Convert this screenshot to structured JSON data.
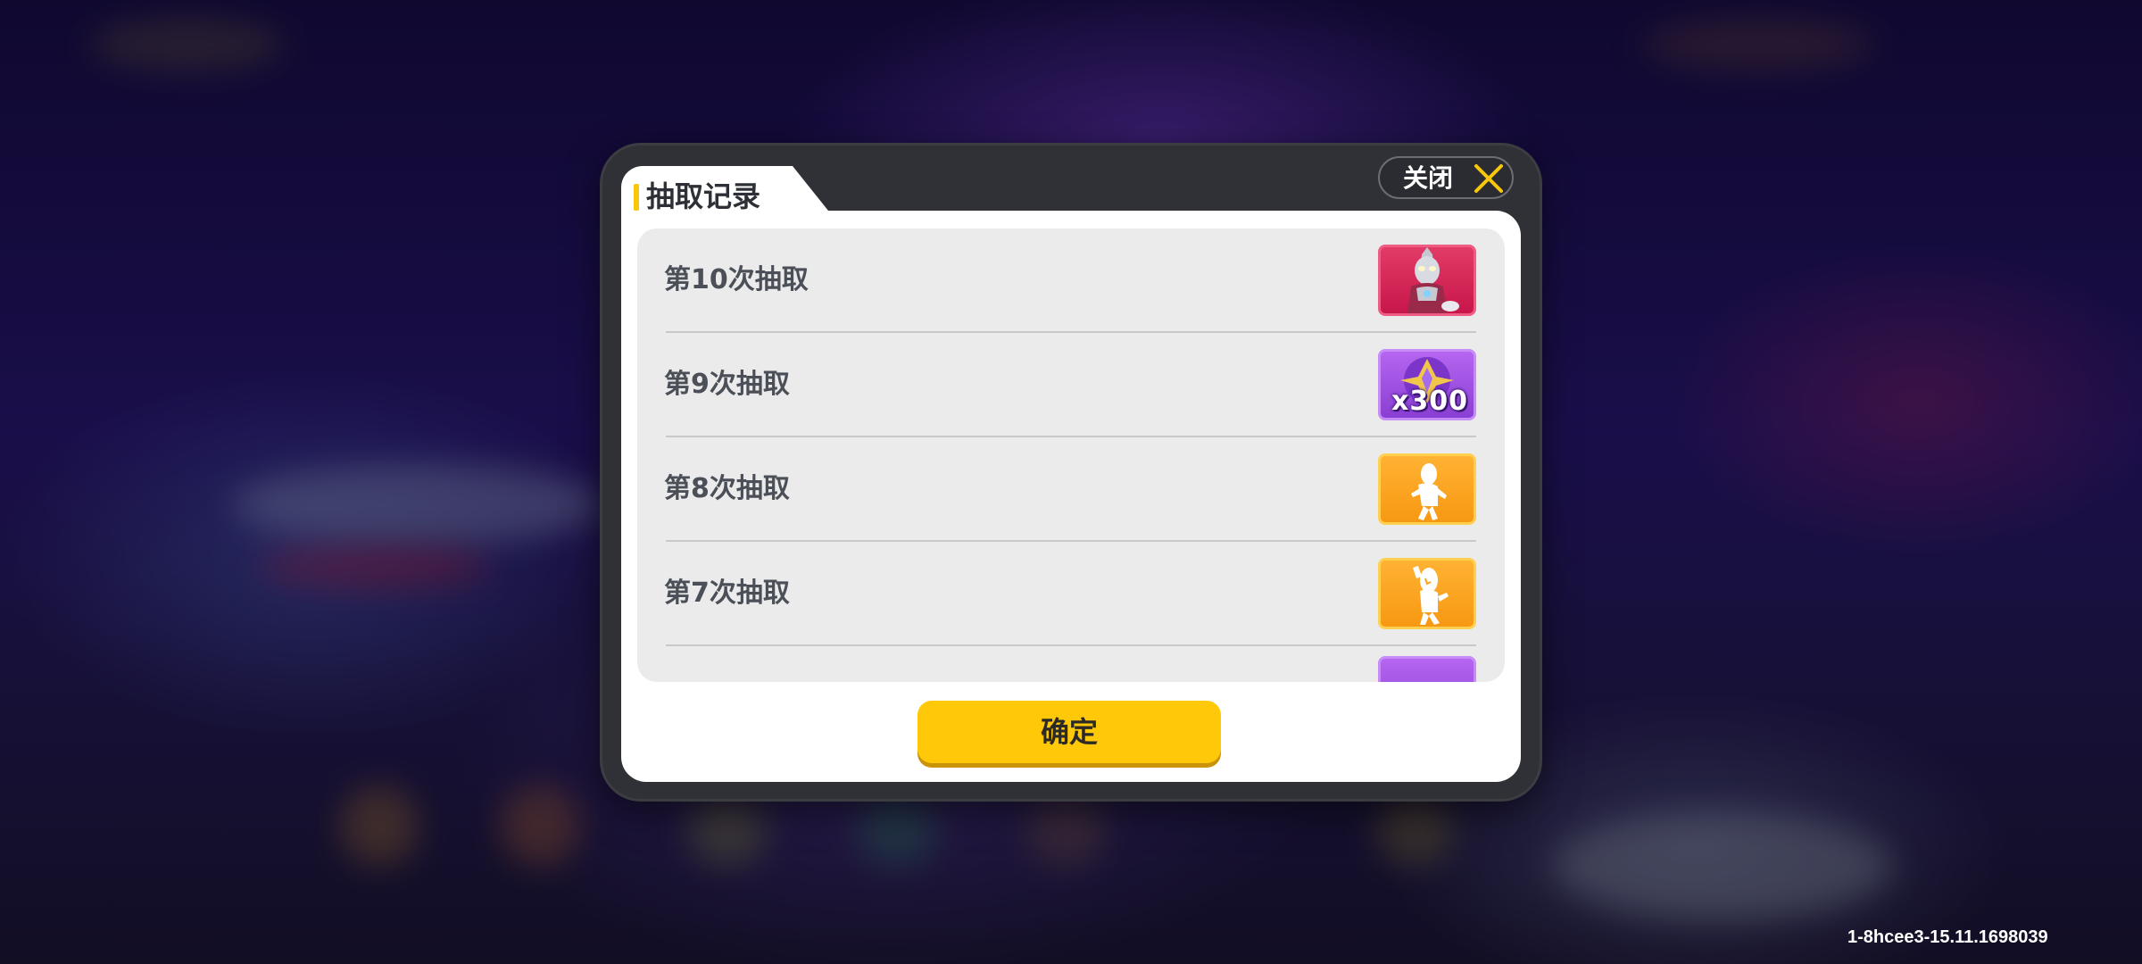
{
  "dialog": {
    "title": "抽取记录",
    "close_label": "关闭",
    "confirm_label": "确定"
  },
  "records": [
    {
      "label": "第10次抽取",
      "reward_icon": "ultraman-figure-icon",
      "reward_color": "#d42457",
      "quantity": ""
    },
    {
      "label": "第9次抽取",
      "reward_icon": "purple-crystal-icon",
      "reward_color": "#9b4fe0",
      "quantity": "x300"
    },
    {
      "label": "第8次抽取",
      "reward_icon": "dancing-character-emote-icon",
      "reward_color": "#f9a220",
      "quantity": ""
    },
    {
      "label": "第7次抽取",
      "reward_icon": "waving-character-emote-icon",
      "reward_color": "#f9a220",
      "quantity": ""
    }
  ],
  "version": "1-8hcee3-15.11.1698039",
  "colors": {
    "accent_yellow": "#ffc90a",
    "panel_dark": "#2f3136"
  }
}
